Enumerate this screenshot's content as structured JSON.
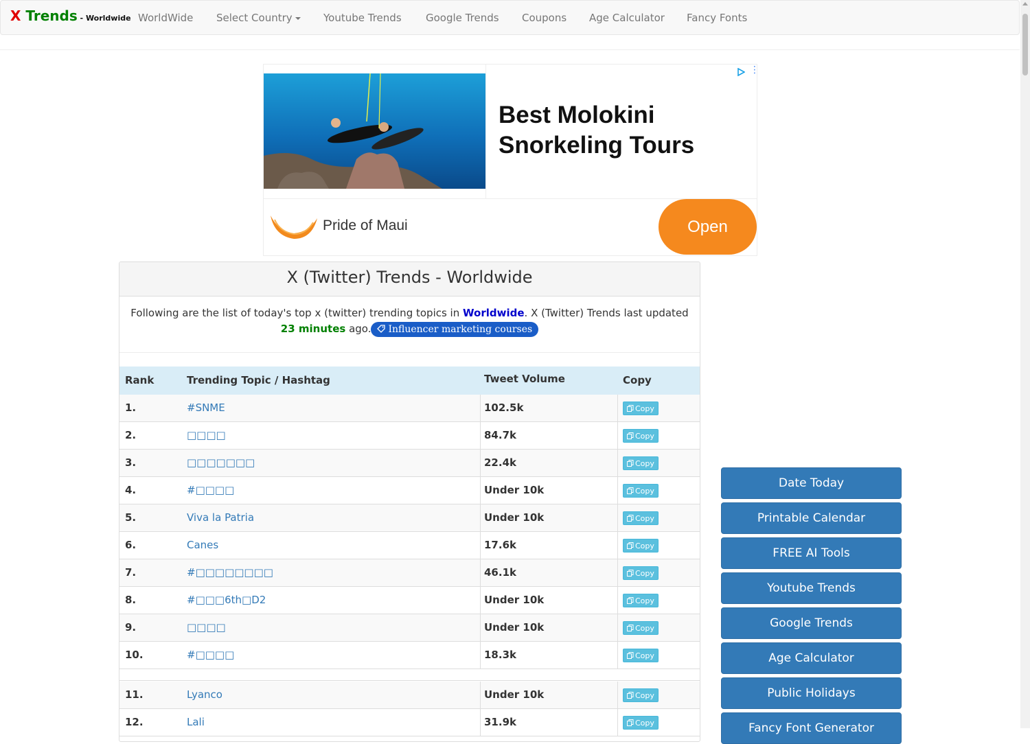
{
  "brand": {
    "x": "X",
    "trends": " Trends",
    "suffix": " - Worldwide"
  },
  "nav": {
    "worldwide": "WorldWide",
    "select_country": "Select Country",
    "youtube_trends": "Youtube Trends",
    "google_trends": "Google Trends",
    "coupons": "Coupons",
    "age_calculator": "Age Calculator",
    "fancy_fonts": "Fancy Fonts"
  },
  "ad": {
    "headline": "Best Molokini Snorkeling Tours",
    "advertiser": "Pride of Maui",
    "cta": "Open",
    "cta_color": "#f5891e"
  },
  "panel": {
    "title": "X (Twitter) Trends - Worldwide",
    "intro_before": "Following are the list of today's top x (twitter) trending topics in ",
    "location": "Worldwide",
    "intro_middle": ". X (Twitter) Trends last updated ",
    "updated": "23 minutes",
    "intro_after": " ago.",
    "pill_label": "Influencer marketing courses"
  },
  "table": {
    "headers": {
      "rank": "Rank",
      "topic": "Trending Topic / Hashtag",
      "volume": "Tweet Volume",
      "copy": "Copy"
    },
    "copy_label": "Copy",
    "rows": [
      {
        "rank": "1.",
        "topic": "#SNME",
        "volume": "102.5k"
      },
      {
        "rank": "2.",
        "topic": "□□□□",
        "volume": "84.7k"
      },
      {
        "rank": "3.",
        "topic": "□□□□□□□",
        "volume": "22.4k"
      },
      {
        "rank": "4.",
        "topic": "#□□□□",
        "volume": "Under 10k"
      },
      {
        "rank": "5.",
        "topic": "Viva la Patria",
        "volume": "Under 10k"
      },
      {
        "rank": "6.",
        "topic": "Canes",
        "volume": "17.6k"
      },
      {
        "rank": "7.",
        "topic": "#□□□□□□□□",
        "volume": "46.1k"
      },
      {
        "rank": "8.",
        "topic": "#□□□6th□D2",
        "volume": "Under 10k"
      },
      {
        "rank": "9.",
        "topic": "□□□□",
        "volume": "Under 10k"
      },
      {
        "rank": "10.",
        "topic": "#□□□□",
        "volume": "18.3k"
      },
      {
        "rank": "11.",
        "topic": "Lyanco",
        "volume": "Under 10k"
      },
      {
        "rank": "12.",
        "topic": "Lali",
        "volume": "31.9k"
      }
    ]
  },
  "sidebar": {
    "buttons": [
      "Date Today",
      "Printable Calendar",
      "FREE AI Tools",
      "Youtube Trends",
      "Google Trends",
      "Age Calculator",
      "Public Holidays",
      "Fancy Font Generator"
    ]
  },
  "colors": {
    "accent": "#337ab7",
    "info": "#5bc0de",
    "header_bg": "#d9edf7",
    "pill": "#1a5dc7"
  }
}
